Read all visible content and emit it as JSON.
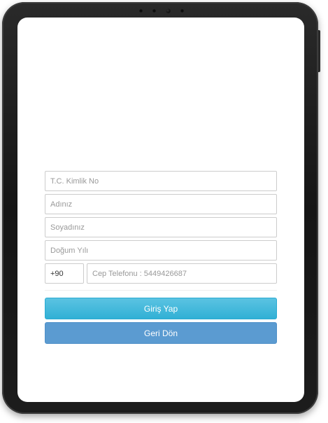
{
  "form": {
    "tc_placeholder": "T.C. Kimlik No",
    "first_name_placeholder": "Adınız",
    "last_name_placeholder": "Soyadınız",
    "birth_year_placeholder": "Doğum Yılı",
    "country_code_value": "+90",
    "phone_placeholder": "Cep Telefonu : 5449426687"
  },
  "buttons": {
    "login_label": "Giriş Yap",
    "back_label": "Geri Dön"
  },
  "colors": {
    "login_button": "#31b0d5",
    "back_button": "#5b9bd1",
    "device_frame": "#1a1a1a"
  }
}
